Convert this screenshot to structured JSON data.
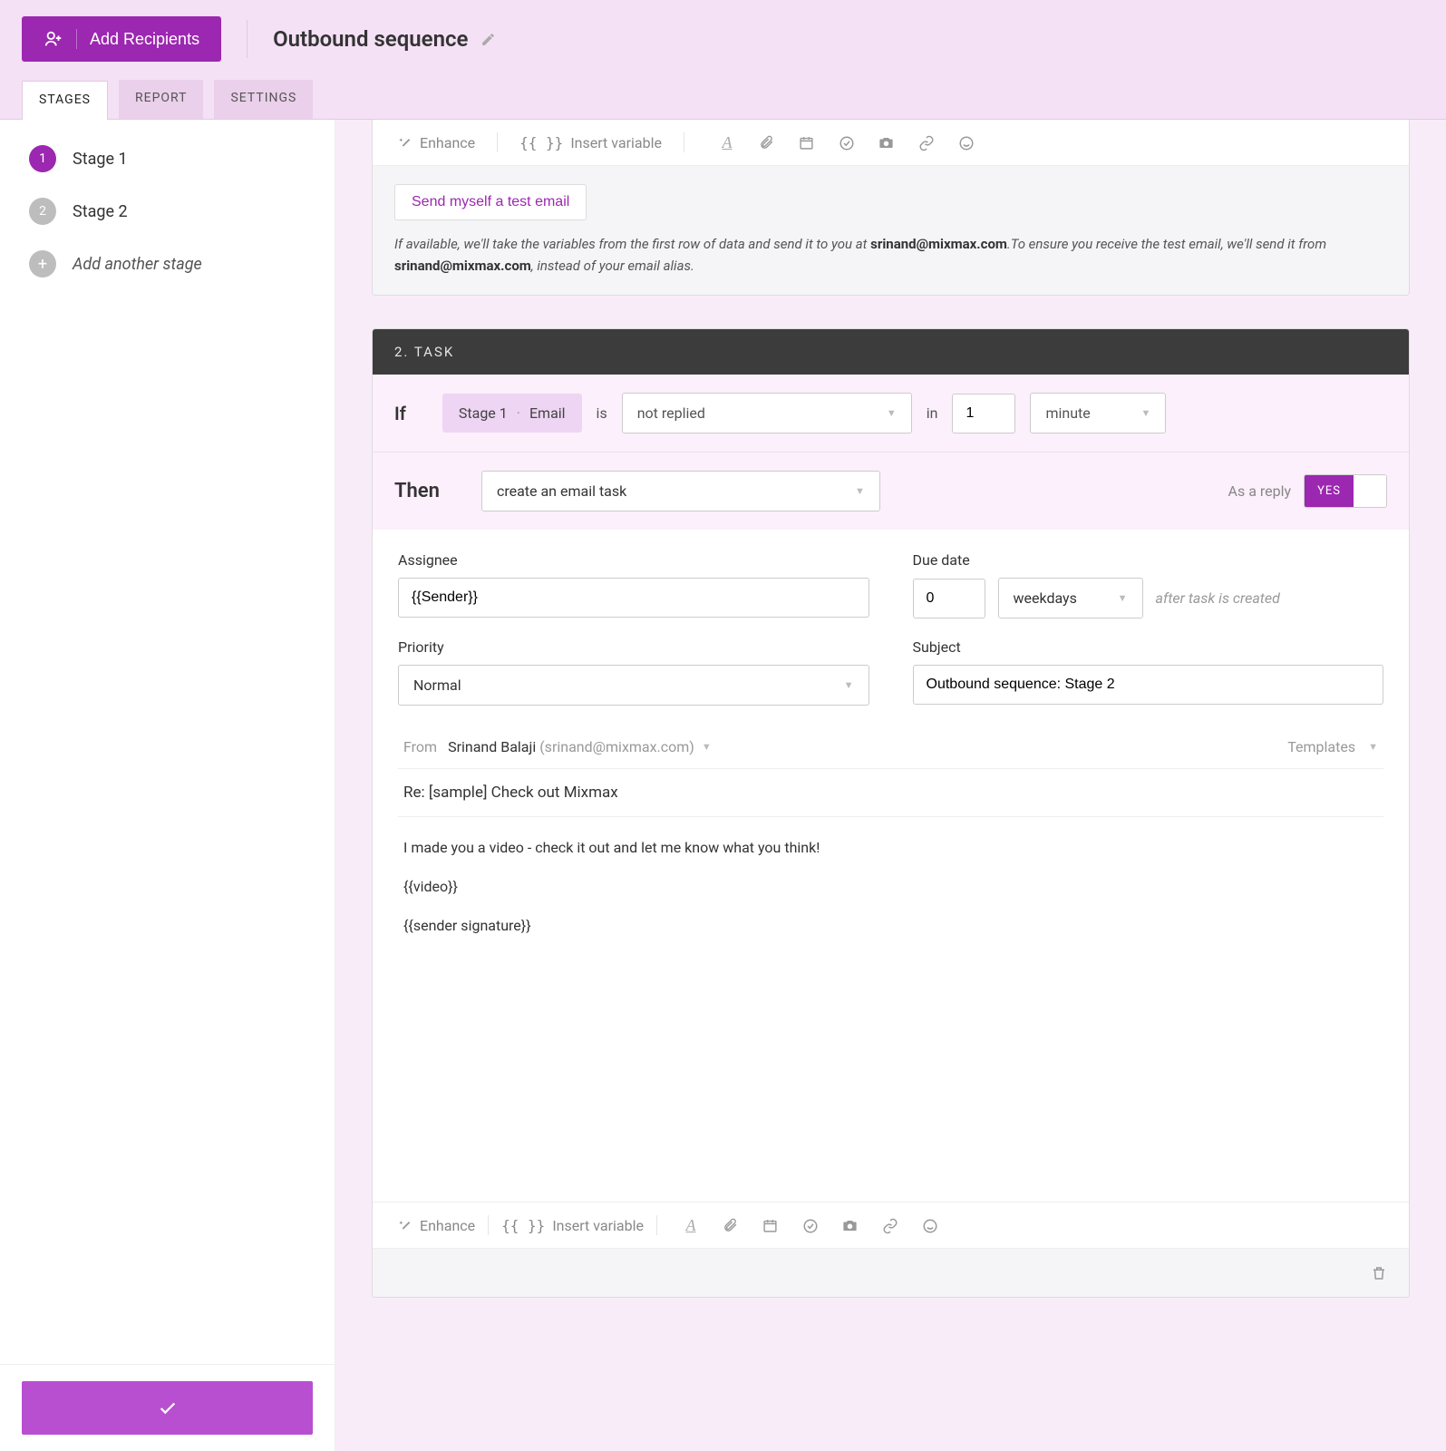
{
  "header": {
    "add_recipients": "Add Recipients",
    "title": "Outbound sequence"
  },
  "tabs": {
    "stages": "STAGES",
    "report": "REPORT",
    "settings": "SETTINGS"
  },
  "sidebar": {
    "stages": [
      {
        "num": "1",
        "label": "Stage 1",
        "active": true
      },
      {
        "num": "2",
        "label": "Stage 2",
        "active": false
      }
    ],
    "add_stage": "Add another stage"
  },
  "card1": {
    "toolbar": {
      "enhance": "Enhance",
      "insert_var_glyph": "{{ }}",
      "insert_var": "Insert variable"
    },
    "test_button": "Send myself a test email",
    "note_p1": "If available, we'll take the variables from the first row of data and send it to you at ",
    "note_email1": "srinand@mixmax.com",
    "note_p2": ".To ensure you receive the test email, we'll send it from ",
    "note_email2": "srinand@mixmax.com",
    "note_p3": ", instead of your email alias."
  },
  "task": {
    "header": "2. TASK",
    "if": "If",
    "pill_stage": "Stage 1",
    "pill_dot": "·",
    "pill_email": "Email",
    "is": "is",
    "condition": "not replied",
    "in": "in",
    "in_val": "1",
    "unit": "minute",
    "then": "Then",
    "action": "create an email task",
    "as_reply": "As a reply",
    "toggle": "YES",
    "assignee_label": "Assignee",
    "assignee_val": "{{Sender}}",
    "due_label": "Due date",
    "due_val": "0",
    "due_unit": "weekdays",
    "due_hint": "after task is created",
    "priority_label": "Priority",
    "priority_val": "Normal",
    "subject_label": "Subject",
    "subject_val": "Outbound sequence: Stage 2",
    "from_label": "From",
    "from_name": "Srinand Balaji",
    "from_email": "(srinand@mixmax.com)",
    "templates": "Templates",
    "email_subject": "Re: [sample] Check out Mixmax",
    "body_l1": "I made you a video - check it out and let me know what you think!",
    "body_l2": "{{video}}",
    "body_l3": "{{sender signature}}",
    "toolbar": {
      "enhance": "Enhance",
      "insert_var_glyph": "{{ }}",
      "insert_var": "Insert variable"
    }
  },
  "icons": {
    "check": "✓"
  }
}
